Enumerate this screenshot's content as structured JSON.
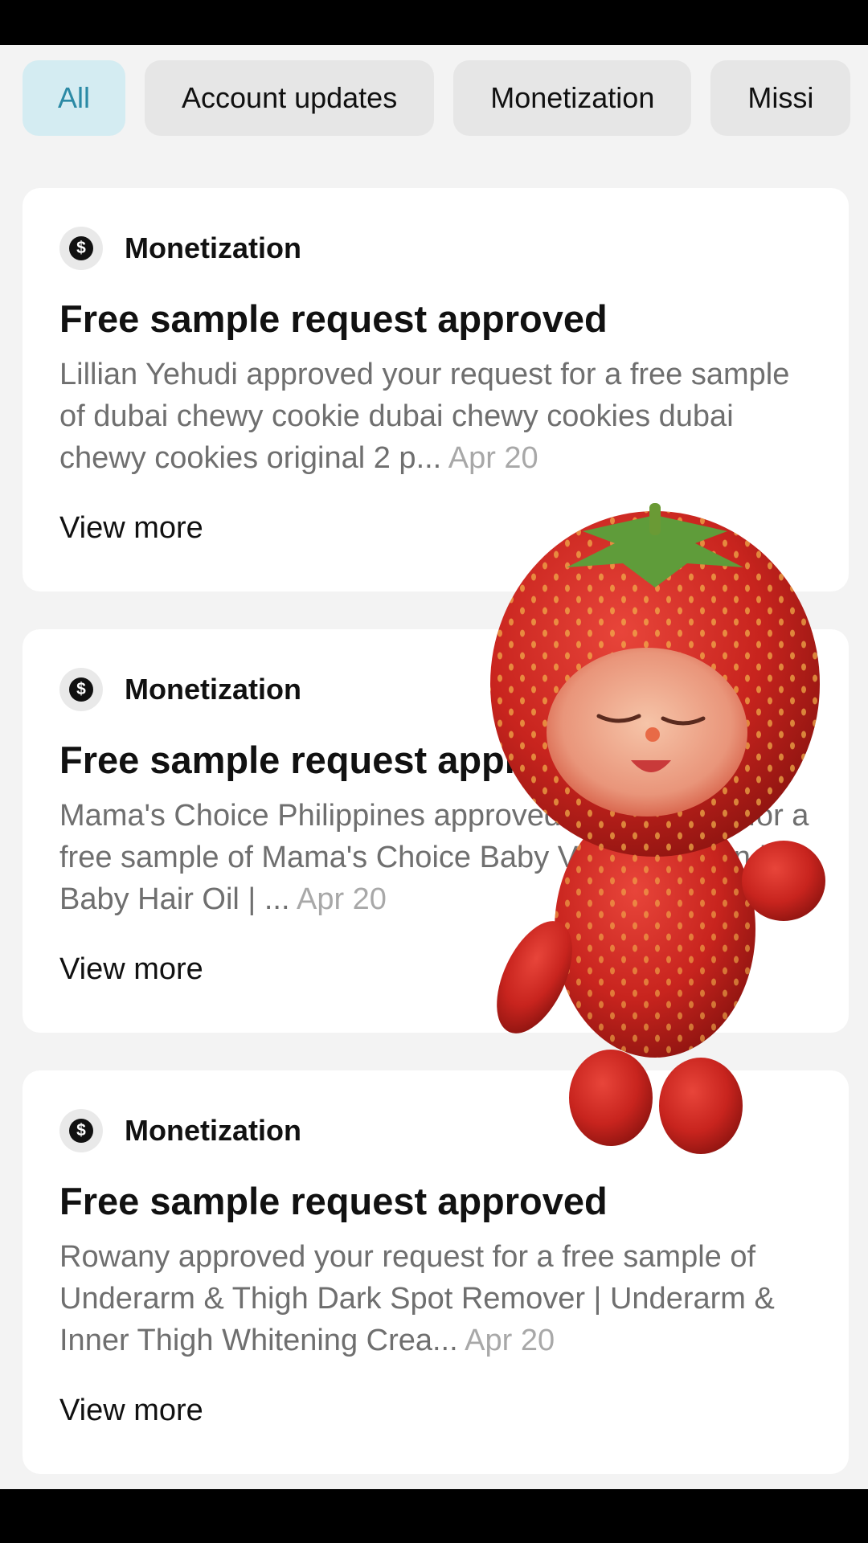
{
  "tabs": [
    {
      "label": "All",
      "active": true
    },
    {
      "label": "Account updates",
      "active": false
    },
    {
      "label": "Monetization",
      "active": false
    },
    {
      "label": "Missi",
      "active": false
    }
  ],
  "cards": [
    {
      "category": "Monetization",
      "category_icon": "dollar-icon",
      "title": "Free sample request approved",
      "body": "Lillian Yehudi approved your request for a free sample of dubai chewy cookie dubai chewy cookies dubai chewy cookies original 2 p...",
      "date": "Apr 20",
      "action": "View more"
    },
    {
      "category": "Monetization",
      "category_icon": "dollar-icon",
      "title": "Free sample request approved",
      "body": "Mama's Choice Philippines approved your request for a free sample of Mama's Choice Baby Vitamin Lotion | Baby Hair Oil | ...",
      "date": "Apr 20",
      "action": "View more"
    },
    {
      "category": "Monetization",
      "category_icon": "dollar-icon",
      "title": "Free sample request approved",
      "body": "Rowany approved your request for a free sample of Underarm & Thigh Dark Spot Remover | Underarm & Inner Thigh Whitening Crea...",
      "date": "Apr 20",
      "action": "View more"
    }
  ],
  "icons": {
    "category": "$"
  },
  "colors": {
    "active_tab_bg": "#d4ecf2",
    "active_tab_text": "#2b8aa5",
    "tab_bg": "#e6e6e6",
    "page_bg": "#f3f3f3"
  }
}
